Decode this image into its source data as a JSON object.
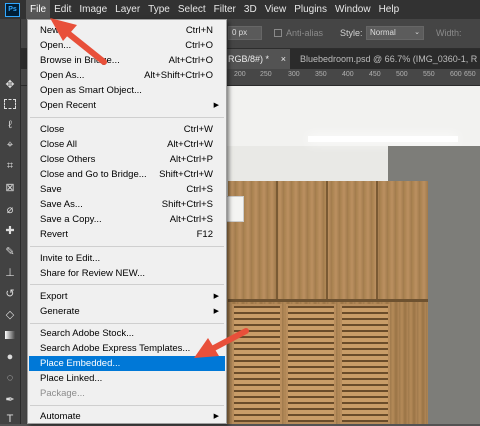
{
  "menubar": {
    "logo": "Ps",
    "items": [
      "File",
      "Edit",
      "Image",
      "Layer",
      "Type",
      "Select",
      "Filter",
      "3D",
      "View",
      "Plugins",
      "Window",
      "Help"
    ]
  },
  "options": {
    "px_value": "0 px",
    "antialias": "Anti-alias",
    "style_label": "Style:",
    "style_value": "Normal",
    "width_label": "Width:"
  },
  "tabs": {
    "active_fragment": "RGB/8#) *",
    "inactive": "Bluebedroom.psd @ 66.7% (IMG_0360-1, R"
  },
  "ruler_marks": [
    "200",
    "250",
    "300",
    "350",
    "400",
    "450",
    "500",
    "550",
    "600",
    "650"
  ],
  "file_menu": {
    "items": [
      {
        "label": "New...",
        "shortcut": "Ctrl+N"
      },
      {
        "label": "Open...",
        "shortcut": "Ctrl+O"
      },
      {
        "label": "Browse in Bridge...",
        "shortcut": "Alt+Ctrl+O"
      },
      {
        "label": "Open As...",
        "shortcut": "Alt+Shift+Ctrl+O"
      },
      {
        "label": "Open as Smart Object...",
        "shortcut": ""
      },
      {
        "label": "Open Recent",
        "shortcut": "",
        "submenu": true
      },
      {
        "label": "Close",
        "shortcut": "Ctrl+W"
      },
      {
        "label": "Close All",
        "shortcut": "Alt+Ctrl+W"
      },
      {
        "label": "Close Others",
        "shortcut": "Alt+Ctrl+P"
      },
      {
        "label": "Close and Go to Bridge...",
        "shortcut": "Shift+Ctrl+W"
      },
      {
        "label": "Save",
        "shortcut": "Ctrl+S"
      },
      {
        "label": "Save As...",
        "shortcut": "Shift+Ctrl+S"
      },
      {
        "label": "Save a Copy...",
        "shortcut": "Alt+Ctrl+S"
      },
      {
        "label": "Revert",
        "shortcut": "F12"
      },
      {
        "label": "Invite to Edit...",
        "shortcut": ""
      },
      {
        "label": "Share for Review NEW...",
        "shortcut": ""
      },
      {
        "label": "Export",
        "shortcut": "",
        "submenu": true
      },
      {
        "label": "Generate",
        "shortcut": "",
        "submenu": true
      },
      {
        "label": "Search Adobe Stock...",
        "shortcut": ""
      },
      {
        "label": "Search Adobe Express Templates...",
        "shortcut": ""
      },
      {
        "label": "Place Embedded...",
        "shortcut": "",
        "highlighted": true
      },
      {
        "label": "Place Linked...",
        "shortcut": ""
      },
      {
        "label": "Package...",
        "shortcut": "",
        "disabled": true
      },
      {
        "label": "Automate",
        "shortcut": "",
        "submenu": true
      }
    ]
  },
  "colors": {
    "highlight": "#0078d7",
    "annotation_arrow": "#e8503a"
  }
}
